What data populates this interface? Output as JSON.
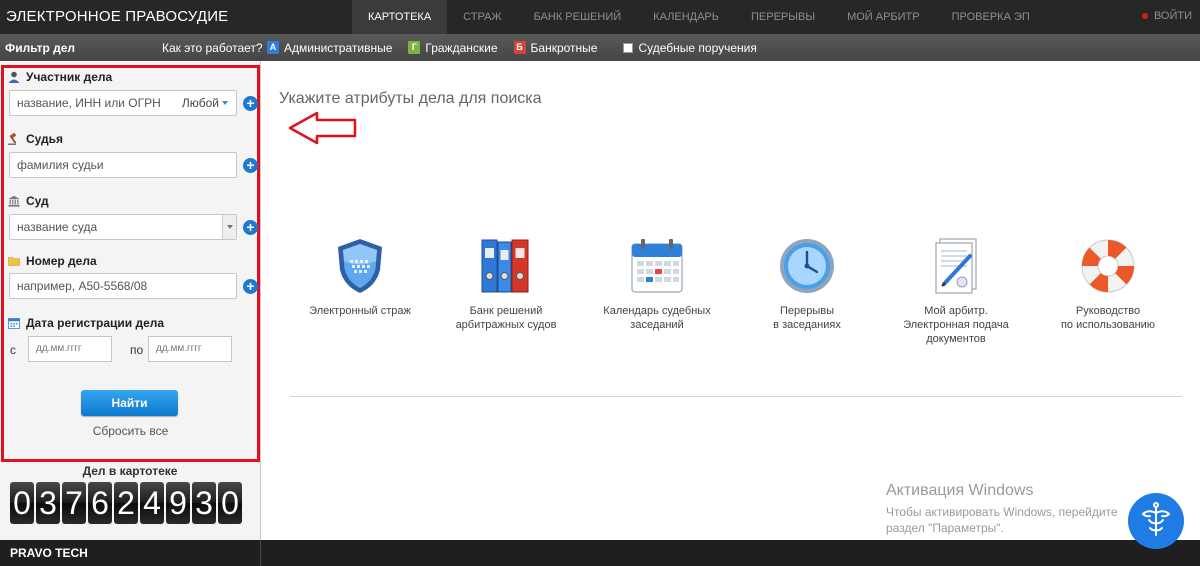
{
  "header": {
    "logo": "ЭЛЕКТРОННОЕ ПРАВОСУДИЕ",
    "nav": [
      "КАРТОТЕКА",
      "СТРАЖ",
      "БАНК РЕШЕНИЙ",
      "КАЛЕНДАРЬ",
      "ПЕРЕРЫВЫ",
      "МОЙ АРБИТР",
      "ПРОВЕРКА ЭП"
    ],
    "active_nav": "КАРТОТЕКА",
    "login": "ВОЙТИ"
  },
  "subbar": {
    "filter_title": "Фильтр дел",
    "how_it_works": "Как это работает?",
    "types": [
      {
        "badge": "А",
        "label": "Административные"
      },
      {
        "badge": "Г",
        "label": "Гражданские"
      },
      {
        "badge": "Б",
        "label": "Банкротные"
      }
    ],
    "court_orders": "Судебные поручения"
  },
  "filter": {
    "participant_label": "Участник дела",
    "participant_placeholder": "название, ИНН или ОГРН",
    "participant_role": "Любой",
    "judge_label": "Судья",
    "judge_placeholder": "фамилия судьи",
    "court_label": "Суд",
    "court_placeholder": "название суда",
    "case_number_label": "Номер дела",
    "case_number_placeholder": "например, А50-5568/08",
    "reg_date_label": "Дата регистрации дела",
    "from_label": "с",
    "to_label": "по",
    "date_from_placeholder": "дд.мм.гггг",
    "date_to_placeholder": "дд.мм.гггг",
    "find_button": "Найти",
    "reset": "Сбросить все"
  },
  "counter": {
    "title": "Дел в картотеке",
    "value": "037624930"
  },
  "main": {
    "hint": "Укажите атрибуты дела для поиска",
    "tiles": [
      {
        "icon": "shield-icon",
        "lines": [
          "Электронный страж"
        ]
      },
      {
        "icon": "binders-icon",
        "lines": [
          "Банк решений",
          "арбитражных судов"
        ]
      },
      {
        "icon": "calendar-icon",
        "lines": [
          "Календарь судебных",
          "заседаний"
        ]
      },
      {
        "icon": "clock-icon",
        "lines": [
          "Перерывы",
          "в заседаниях"
        ]
      },
      {
        "icon": "document-pen-icon",
        "lines": [
          "Мой арбитр.",
          "Электронная подача",
          "документов"
        ]
      },
      {
        "icon": "lifebuoy-icon",
        "lines": [
          "Руководство",
          "по использованию"
        ]
      }
    ]
  },
  "footer": {
    "brand": "PRAVO TECH"
  },
  "windows_activation": {
    "title": "Активация Windows",
    "line1": "Чтобы активировать Windows, перейдите",
    "line2": "раздел \"Параметры\"."
  },
  "colors": {
    "accent": "#1d78cf",
    "highlight_border": "#e0101e",
    "topbar": "#272727"
  }
}
